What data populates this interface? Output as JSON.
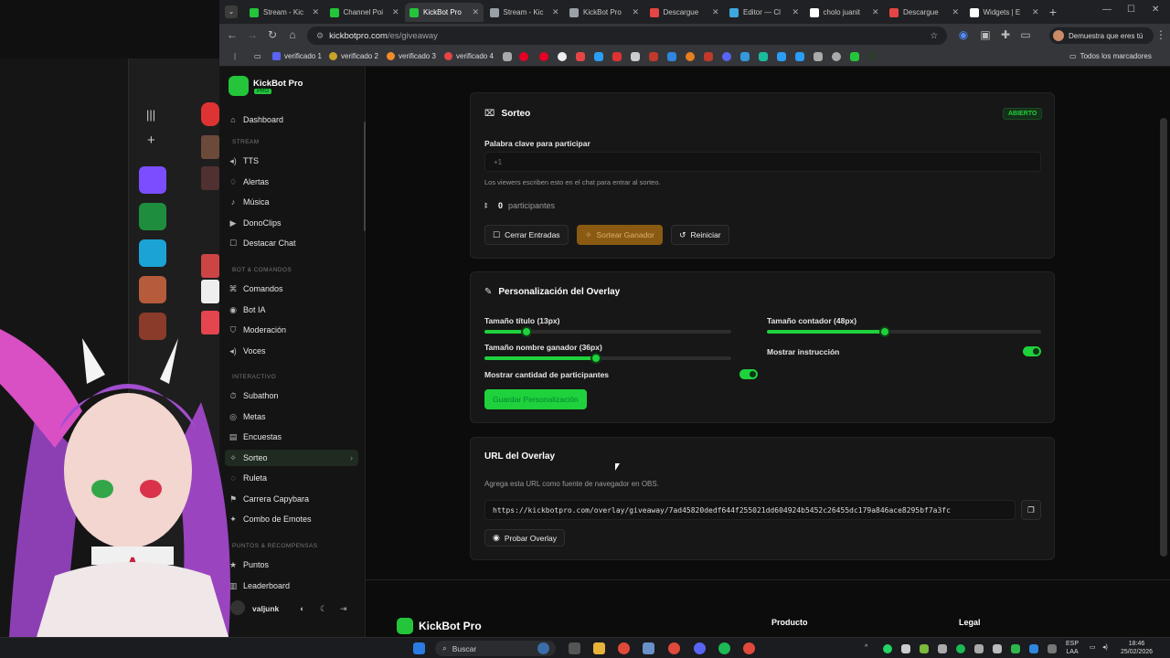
{
  "browser": {
    "tabs": [
      {
        "title": "Stream - Kic",
        "color": "#24c53a"
      },
      {
        "title": "Channel Poi",
        "color": "#24c53a"
      },
      {
        "title": "KickBot Pro",
        "color": "#24c53a",
        "active": true
      },
      {
        "title": "Stream - Kic",
        "color": "#9aa0a6"
      },
      {
        "title": "KickBot Pro",
        "color": "#9aa0a6"
      },
      {
        "title": "Descargue",
        "color": "#e64545"
      },
      {
        "title": "Editor — Cl",
        "color": "#3fa7e0"
      },
      {
        "title": "cholo juanit",
        "color": "#ffffff"
      },
      {
        "title": "Descargue",
        "color": "#e64545"
      },
      {
        "title": "Widgets | E",
        "color": "#ffffff"
      }
    ],
    "url_host": "kickbotpro.com",
    "url_path": "/es/giveaway",
    "profile_label": "Demuestra que eres tú",
    "bookmarks": [
      "verificado 1",
      "verificado 2",
      "verificado 3",
      "verificado 4"
    ],
    "all_bookmarks_label": "Todos los marcadores"
  },
  "sidebar": {
    "brand": "KickBot Pro",
    "brand_badge": "PRO",
    "dashboard": "Dashboard",
    "section_stream": "STREAM",
    "stream_items": [
      "TTS",
      "Alertas",
      "Música",
      "DonoClips",
      "Destacar Chat"
    ],
    "section_bot": "BOT & COMANDOS",
    "bot_items": [
      "Comandos",
      "Bot IA",
      "Moderación",
      "Voces"
    ],
    "section_interactive": "INTERACTIVO",
    "interactive_items": [
      "Subathon",
      "Metas",
      "Encuestas",
      "Sorteo",
      "Ruleta",
      "Carrera Capybara",
      "Combo de Emotes"
    ],
    "section_points": "PUNTOS & RECOMPENSAS",
    "points_items": [
      "Puntos",
      "Leaderboard"
    ],
    "user": "valjunk"
  },
  "giveaway": {
    "title": "Sorteo",
    "status": "ABIERTO",
    "keyword_label": "Palabra clave para participar",
    "keyword_value": "+1",
    "keyword_help": "Los viewers escriben esto en el chat para entrar al sorteo.",
    "participants_count": "0",
    "participants_label": "participantes",
    "btn_close": "Cerrar Entradas",
    "btn_draw": "Sortear Ganador",
    "btn_reset": "Reiniciar"
  },
  "overlay_custom": {
    "title": "Personalización del Overlay",
    "title_size_label": "Tamaño título (13px)",
    "title_size_fraction": 0.17,
    "counter_size_label": "Tamaño contador (48px)",
    "counter_size_fraction": 0.43,
    "winner_size_label": "Tamaño nombre ganador (36px)",
    "winner_size_fraction": 0.45,
    "show_instruction_label": "Mostrar instrucción",
    "show_count_label": "Mostrar cantidad de participantes",
    "save_label": "Guardar Personalización"
  },
  "overlay_url": {
    "title": "URL del Overlay",
    "help": "Agrega esta URL como fuente de navegador en OBS.",
    "url": "https://kickbotpro.com/overlay/giveaway/7ad45820dedf644f255021dd604924b5452c26455dc179a846ace8295bf7a3fc",
    "test_label": "Probar Overlay"
  },
  "footer": {
    "brand": "KickBot Pro",
    "col_product": "Producto",
    "col_legal": "Legal"
  },
  "taskbar": {
    "search": "Buscar",
    "lang": "ESP",
    "lang2": "LAA",
    "time": "18:46",
    "date": "25/02/2026"
  },
  "colors": {
    "accent": "#1fd13c",
    "gold": "#8a5a12"
  }
}
